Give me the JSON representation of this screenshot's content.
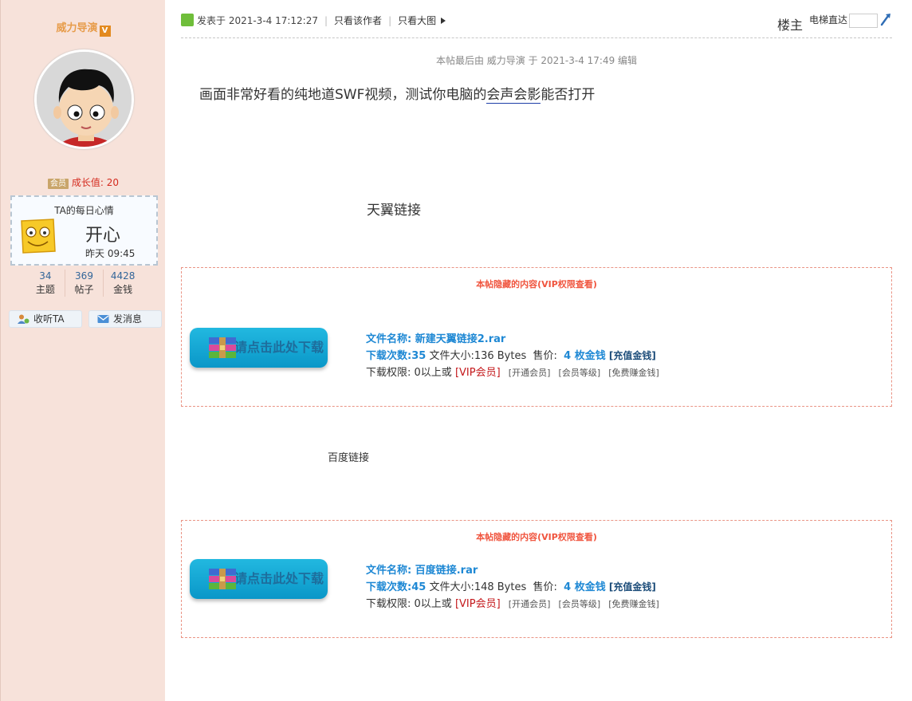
{
  "user": {
    "name": "威力导演",
    "vip_badge": "会员",
    "growth": "成长值: 20",
    "mood": {
      "title": "TA的每日心情",
      "word": "开心",
      "time": "昨天 09:45"
    },
    "stats": [
      {
        "value": "34",
        "label": "主题"
      },
      {
        "value": "369",
        "label": "帖子"
      },
      {
        "value": "4428",
        "label": "金钱"
      }
    ],
    "follow_label": "收听TA",
    "message_label": "发消息"
  },
  "post": {
    "posted": "发表于 2021-3-4 17:12:27",
    "only_author": "只看该作者",
    "big_image": "只看大图",
    "floor": "楼主",
    "jump_label": "电梯直达",
    "last_edit": "本帖最后由 威力导演 于 2021-3-4 17:49 编辑",
    "headline_pre": "画面非常好看的纯地道SWF视频，测试你电脑的",
    "headline_link": "会声会影",
    "headline_post": "能否打开",
    "label_tianyi": "天翼链接",
    "label_baidu": "百度链接"
  },
  "attachments": [
    {
      "hidden_title": "本帖隐藏的内容(VIP权限查看)",
      "button": "请点击此处下载",
      "file_name": "文件名称: 新建天翼链接2.rar",
      "downloads": "下载次数:35",
      "size": "文件大小:136 Bytes",
      "price_label": "售价:",
      "price": "4 枚金钱",
      "recharge": "[充值金钱]",
      "perm_pre": "下载权限: 0以上或",
      "perm_vip": "[VIP会员]",
      "link_open": "[开通会员]",
      "link_level": "[会员等级]",
      "link_free": "[免费赚金钱]"
    },
    {
      "hidden_title": "本帖隐藏的内容(VIP权限查看)",
      "button": "请点击此处下载",
      "file_name": "文件名称: 百度链接.rar",
      "downloads": "下载次数:45",
      "size": "文件大小:148 Bytes",
      "price_label": "售价:",
      "price": "4 枚金钱",
      "recharge": "[充值金钱]",
      "perm_pre": "下载权限: 0以上或",
      "perm_vip": "[VIP会员]",
      "link_open": "[开通会员]",
      "link_level": "[会员等级]",
      "link_free": "[免费赚金钱]"
    }
  ],
  "colors": {
    "sidebar_bg": "#f7e2da",
    "hidden_title": "#f0553f",
    "file_blue": "#1e88d4",
    "button": "#0a97c8"
  }
}
